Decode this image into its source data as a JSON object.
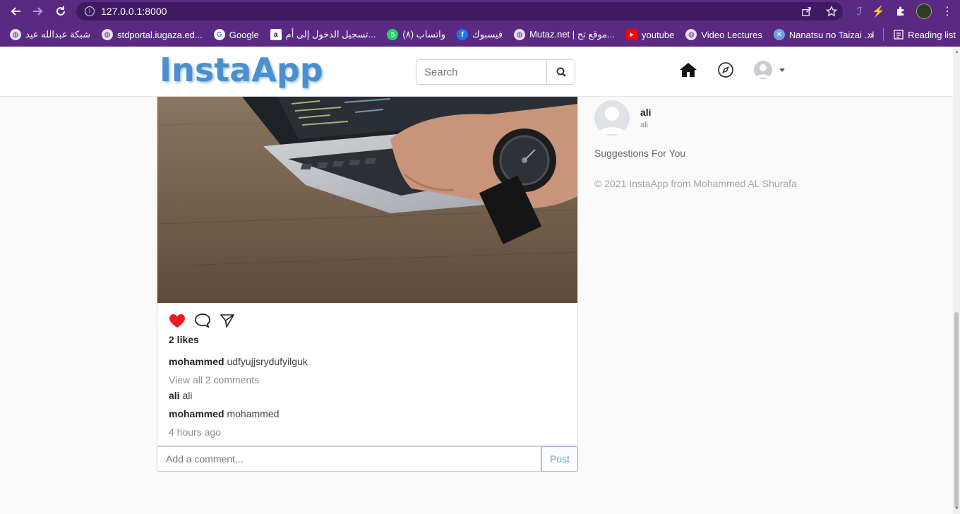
{
  "browser": {
    "url": "127.0.0.1:8000",
    "bookmarks": [
      {
        "label": "شبكة عبدالله عيد",
        "icon": "globe-icon"
      },
      {
        "label": "stdportal.iugaza.ed...",
        "icon": "globe-icon"
      },
      {
        "label": "Google",
        "icon": "google-icon"
      },
      {
        "label": "تسجيل الدخول إلى أم...",
        "icon": "amazon-icon"
      },
      {
        "label": "(٨) واتساب",
        "icon": "whatsapp-icon"
      },
      {
        "label": "فيسبوك",
        "icon": "facebook-icon"
      },
      {
        "label": "Mutaz.net | موقع تح...",
        "icon": "globe-icon"
      },
      {
        "label": "youtube",
        "icon": "youtube-icon"
      },
      {
        "label": "Video Lectures",
        "icon": "globe-icon"
      },
      {
        "label": "Nanatsu no Taizai ...l",
        "icon": "anime-icon"
      }
    ],
    "more": "»",
    "reading_list": "Reading list"
  },
  "navbar": {
    "logo": "InstaApp",
    "search_placeholder": "Search"
  },
  "post": {
    "likes": "2 likes",
    "caption_user": "mohammed",
    "caption_text": "udfyujjsrydufyilguk",
    "view_comments": "View all 2 comments",
    "comments": [
      {
        "user": "ali",
        "text": "ali"
      },
      {
        "user": "mohammed",
        "text": "mohammed"
      }
    ],
    "time": "4 hours ago",
    "comment_placeholder": "Add a comment...",
    "post_label": "Post",
    "liked": true
  },
  "sidebar": {
    "name": "ali",
    "handle": "ali",
    "suggestions": "Suggestions For You",
    "copyright": "© 2021 InstaApp from Mohammed AL Shurafa"
  },
  "colors": {
    "browser": "#5a2a82",
    "heart": "#ed1c24",
    "logo": "#4a8fd0",
    "post_button": "#6aa6de"
  }
}
